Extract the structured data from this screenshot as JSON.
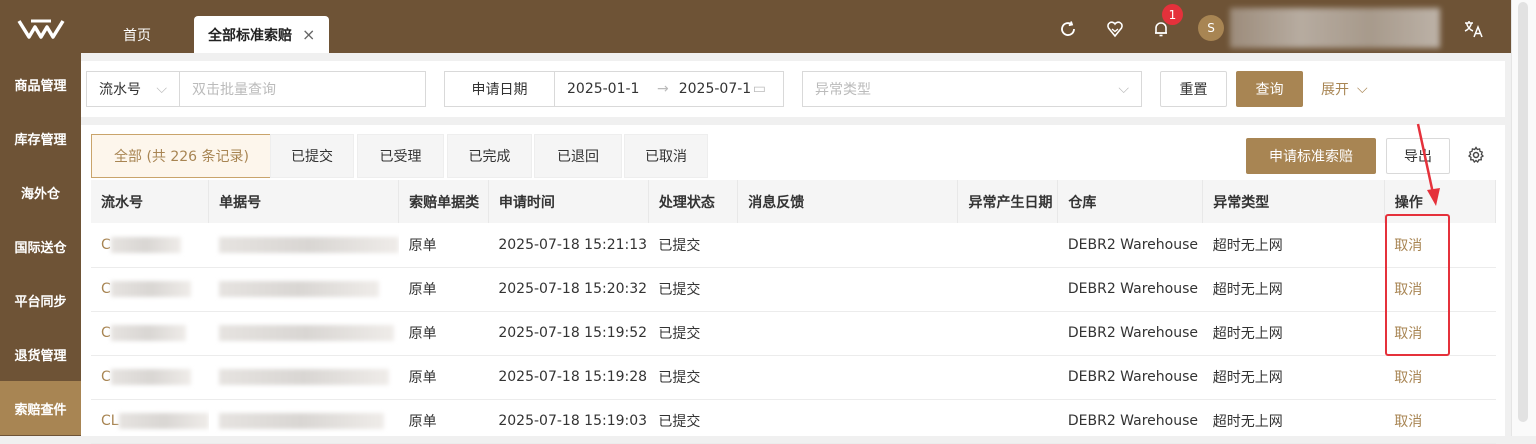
{
  "sidebar": {
    "items": [
      {
        "label": "商品管理"
      },
      {
        "label": "库存管理"
      },
      {
        "label": "海外仓"
      },
      {
        "label": "国际送仓"
      },
      {
        "label": "平台同步"
      },
      {
        "label": "退货管理"
      },
      {
        "label": "索赔查件",
        "active": true
      }
    ]
  },
  "topbar": {
    "tabs": [
      {
        "label": "首页"
      },
      {
        "label": "全部标准索赔",
        "close": "×"
      }
    ],
    "notification_count": "1",
    "avatar_initial": "S",
    "icons": [
      "refresh-icon",
      "heart-shield-icon",
      "bell-icon",
      "translate-icon"
    ]
  },
  "filter": {
    "serial_select": "流水号",
    "batch_placeholder": "双击批量查询",
    "date_label": "申请日期",
    "date_start": "2025-01-1",
    "date_end": "2025-07-1",
    "date_sep": "→",
    "exception_placeholder": "异常类型",
    "reset": "重置",
    "search": "查询",
    "expand": "展开"
  },
  "status_tabs": [
    {
      "label": "全部 (共 226 条记录)",
      "active": true
    },
    {
      "label": "已提交"
    },
    {
      "label": "已受理"
    },
    {
      "label": "已完成"
    },
    {
      "label": "已退回"
    },
    {
      "label": "已取消"
    }
  ],
  "actions": {
    "apply": "申请标准索赔",
    "export": "导出"
  },
  "table": {
    "headers": [
      "流水号",
      "单据号",
      "索赔单据类",
      "申请时间",
      "处理状态",
      "消息反馈",
      "异常产生日期",
      "仓库",
      "异常类型",
      "操作"
    ],
    "rows": [
      {
        "serial": "C",
        "doc_type": "原单",
        "time": "2025-07-18 15:21:13",
        "status": "已提交",
        "feedback": "",
        "date": "",
        "warehouse": "DEBR2 Warehouse",
        "exception": "超时无上网",
        "op": "取消"
      },
      {
        "serial": "C",
        "doc_type": "原单",
        "time": "2025-07-18 15:20:32",
        "status": "已提交",
        "feedback": "",
        "date": "",
        "warehouse": "DEBR2 Warehouse",
        "exception": "超时无上网",
        "op": "取消"
      },
      {
        "serial": "C",
        "doc_type": "原单",
        "time": "2025-07-18 15:19:52",
        "status": "已提交",
        "feedback": "",
        "date": "",
        "warehouse": "DEBR2 Warehouse",
        "exception": "超时无上网",
        "op": "取消"
      },
      {
        "serial": "C",
        "doc_type": "原单",
        "time": "2025-07-18 15:19:28",
        "status": "已提交",
        "feedback": "",
        "date": "",
        "warehouse": "DEBR2 Warehouse",
        "exception": "超时无上网",
        "op": "取消"
      },
      {
        "serial": "CL",
        "doc_type": "原单",
        "time": "2025-07-18 15:19:03",
        "status": "已提交",
        "feedback": "",
        "date": "",
        "warehouse": "DEBR2 Warehouse",
        "exception": "超时无上网",
        "op": "取消"
      }
    ]
  },
  "colors": {
    "brand": "#6e5336",
    "accent": "#a88553",
    "highlight": "#e5313b"
  }
}
